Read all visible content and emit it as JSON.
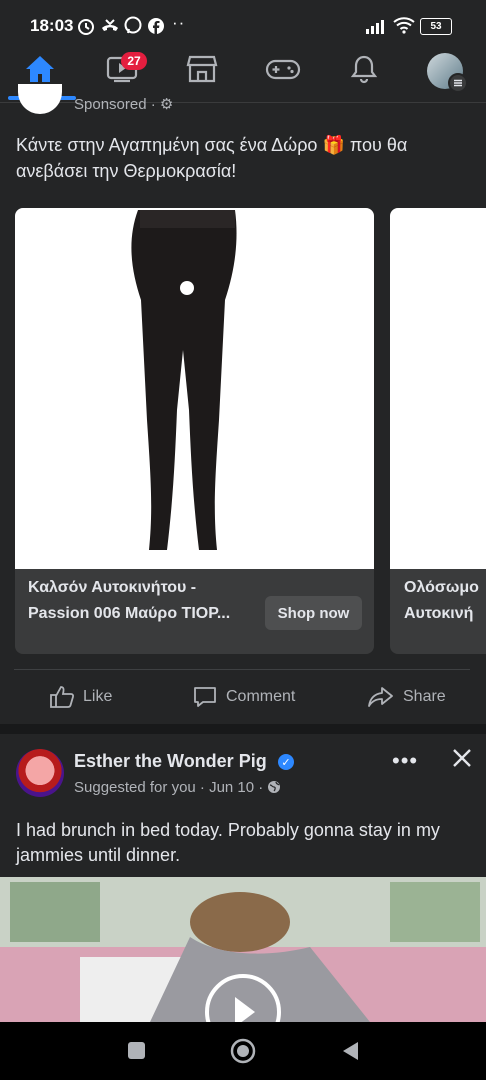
{
  "status_bar": {
    "time": "18:03",
    "dots": "··",
    "battery": "53"
  },
  "nav": {
    "notification_badge": "27",
    "active_tab": "home"
  },
  "sponsored_post": {
    "sponsored_label": "Sponsored · ⚙",
    "text": "Κάντε στην Αγαπημένη σας ένα  Δώρο 🎁 που θα ανεβάσει την Θερμοκρασία!",
    "cards": [
      {
        "title": "Καλσόν Αυτοκινήτου - Passion 006 Μαύρο ΤΙΟΡ...",
        "button": "Shop now"
      },
      {
        "title": "Ολόσωμο Αυτοκινή"
      }
    ],
    "actions": {
      "like": "Like",
      "comment": "Comment",
      "share": "Share"
    }
  },
  "suggested_post": {
    "page_name": "Esther the Wonder Pig",
    "meta": "Suggested for you · Jun 10 · ",
    "text": "I had brunch in bed today. Probably gonna stay in my jammies until dinner."
  },
  "colors": {
    "accent": "#2d88ff",
    "badge": "#e41e3f",
    "background": "#242526"
  }
}
